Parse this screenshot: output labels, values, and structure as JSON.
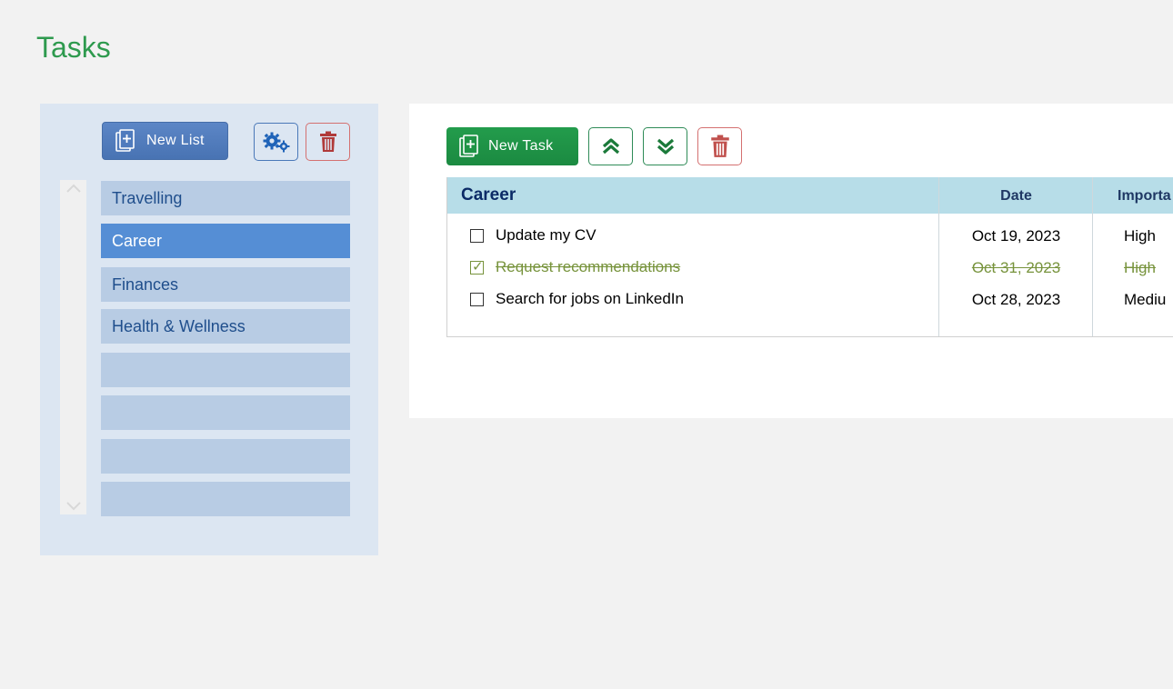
{
  "page": {
    "title": "Tasks"
  },
  "lists_panel": {
    "new_list_label": "New List",
    "items": [
      {
        "label": "Travelling",
        "selected": false
      },
      {
        "label": "Career",
        "selected": true
      },
      {
        "label": "Finances",
        "selected": false
      },
      {
        "label": "Health & Wellness",
        "selected": false
      },
      {
        "label": "",
        "selected": false
      },
      {
        "label": "",
        "selected": false
      },
      {
        "label": "",
        "selected": false
      },
      {
        "label": "",
        "selected": false
      }
    ]
  },
  "tasks_panel": {
    "new_task_label": "New Task",
    "table": {
      "list_name": "Career",
      "date_header": "Date",
      "importance_header": "Importa",
      "rows": [
        {
          "title": "Update my CV",
          "date": "Oct 19, 2023",
          "importance": "High",
          "done": false
        },
        {
          "title": "Request recommendations",
          "date": "Oct 31, 2023",
          "importance": "High",
          "done": true
        },
        {
          "title": "Search for jobs on LinkedIn",
          "date": "Oct 28, 2023",
          "importance": "Mediu",
          "done": false
        }
      ]
    }
  },
  "colors": {
    "title_green": "#2e9a4e",
    "list_item": "#b8cce4",
    "list_item_selected": "#558ed5",
    "header_bg": "#b7dde8",
    "done_green": "#77933c",
    "delete_red": "#c0504d"
  },
  "icons": {
    "new_list": "document-plus-icon",
    "settings": "gears-icon",
    "delete": "trash-icon",
    "move_up": "double-chevron-up-icon",
    "move_down": "double-chevron-down-icon"
  }
}
